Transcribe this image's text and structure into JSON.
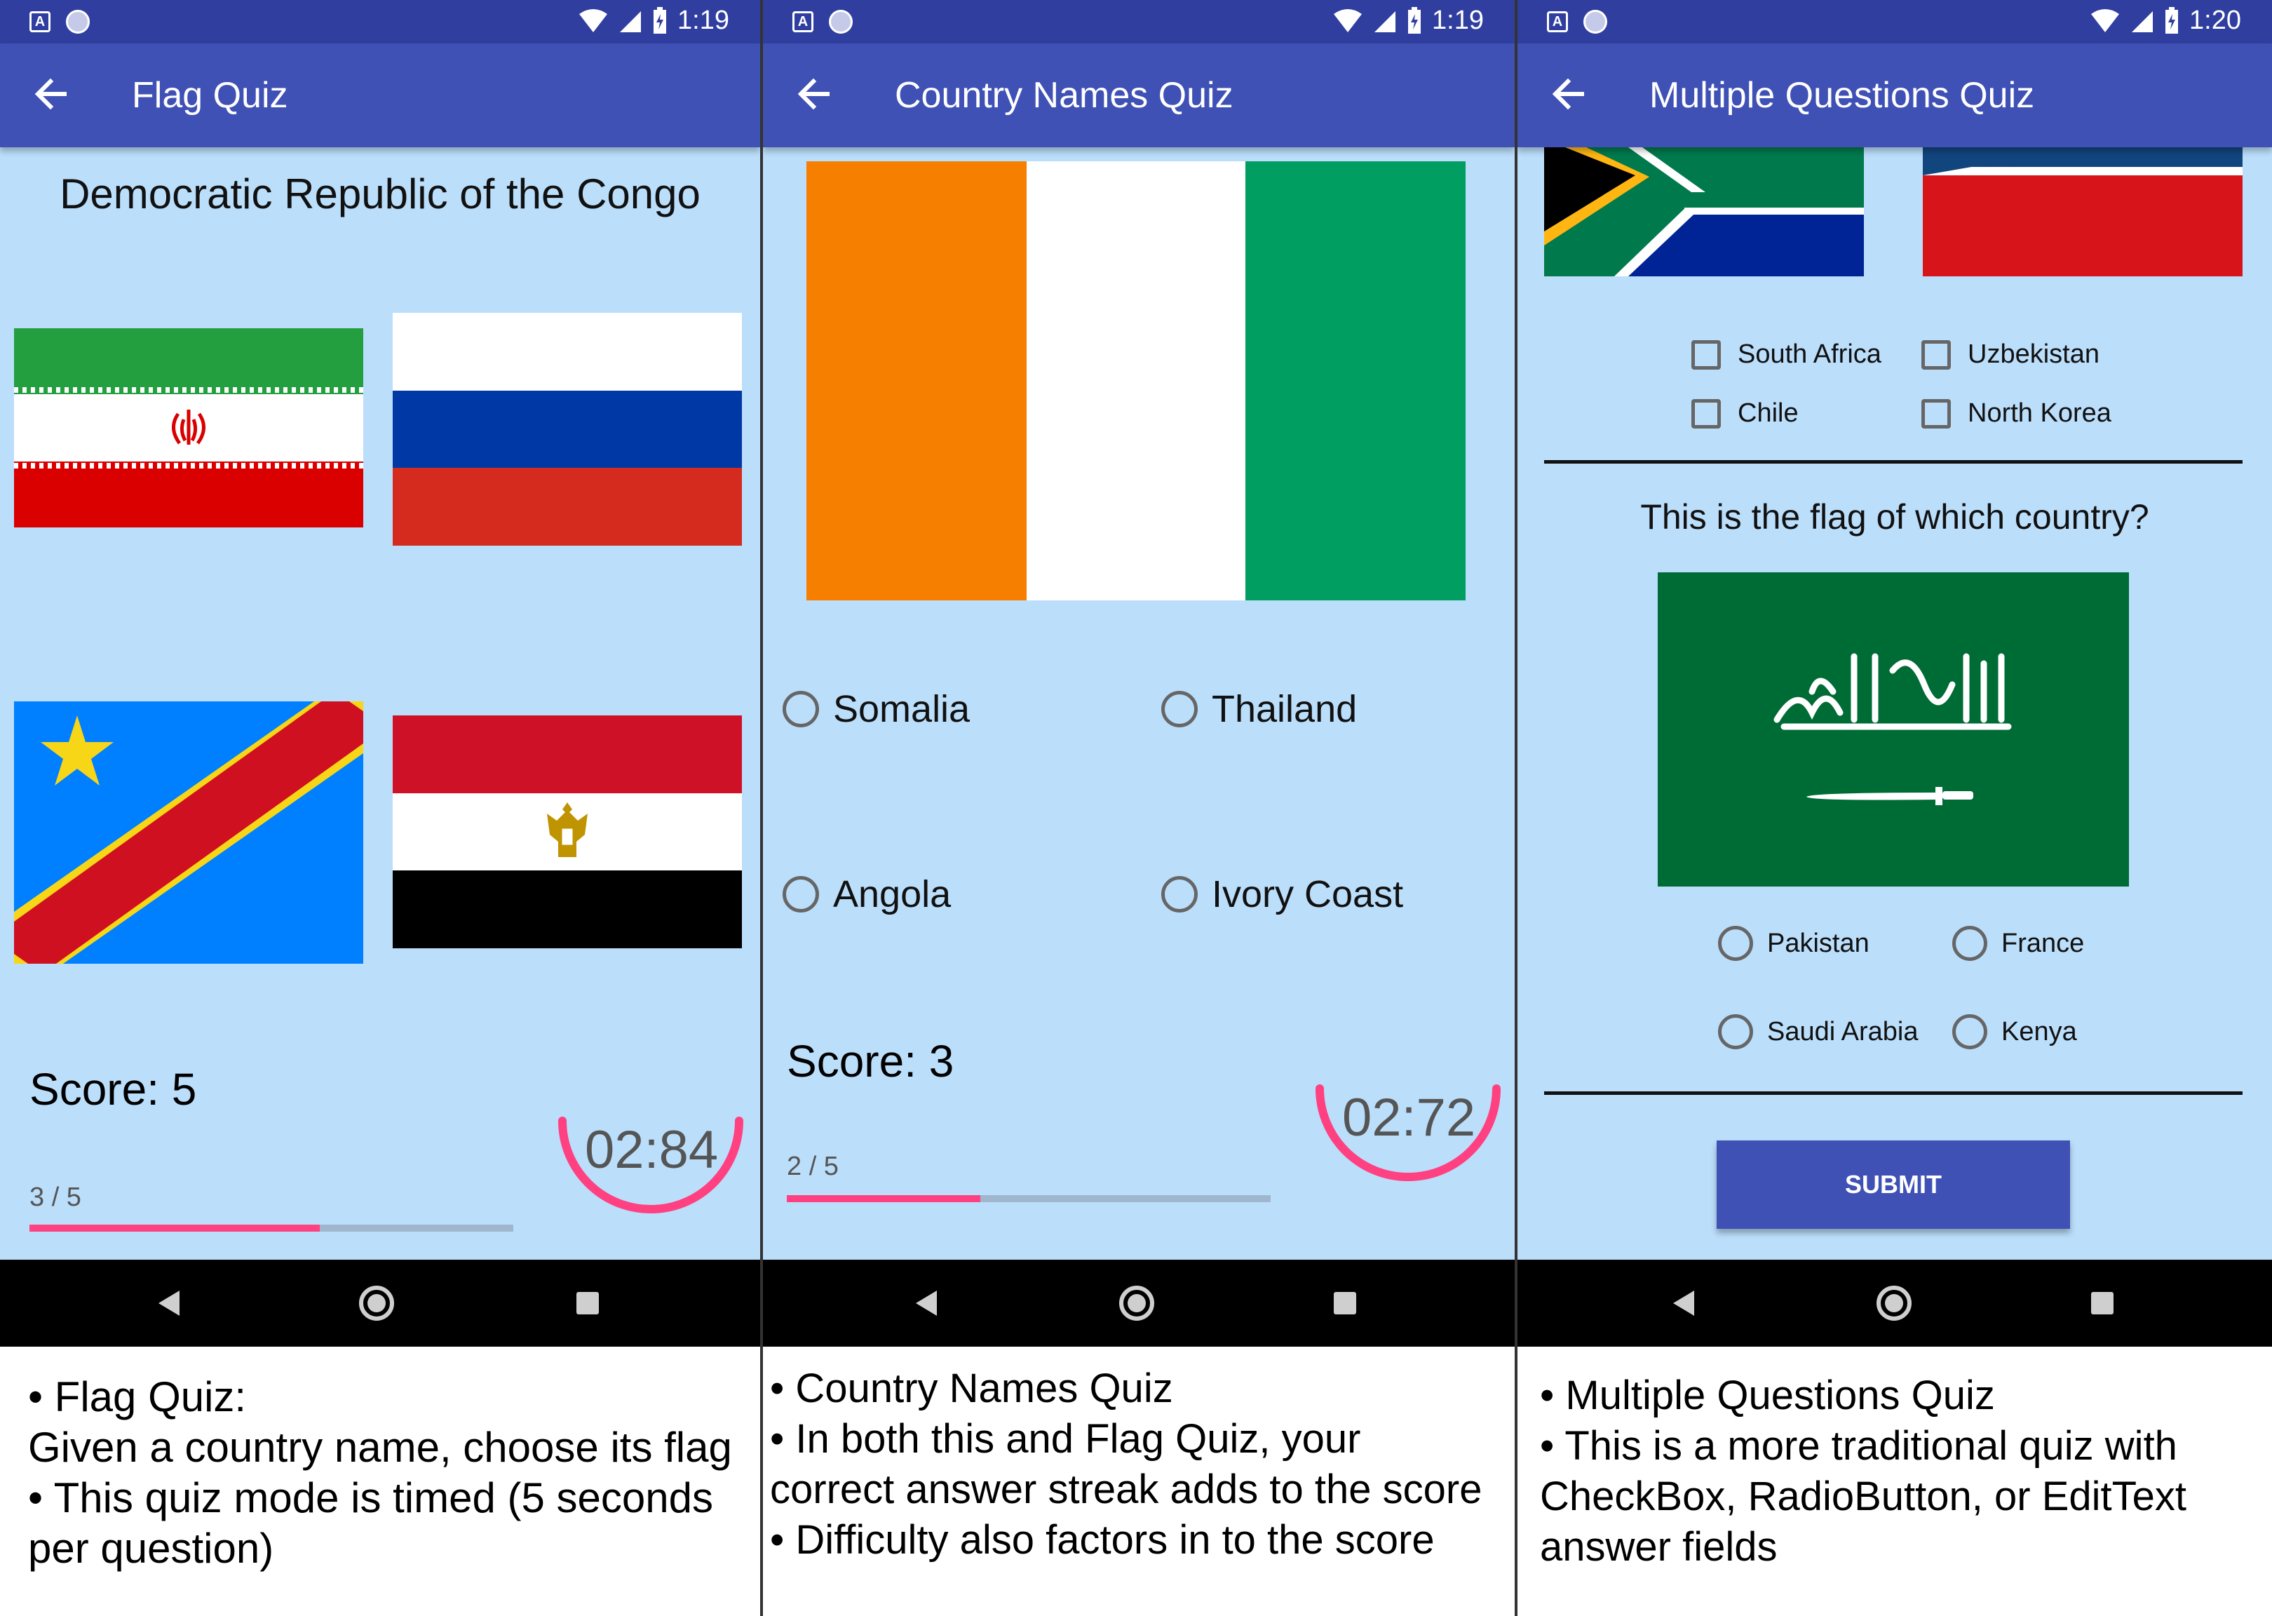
{
  "panels": [
    {
      "status": {
        "time": "1:19"
      },
      "title": "Flag Quiz",
      "question": "Democratic Republic of the Congo",
      "flags": [
        "iran-flag",
        "russia-flag",
        "dr-congo-flag",
        "egypt-flag"
      ],
      "score": "Score: 5",
      "progress": {
        "label": "3 / 5",
        "fraction": 0.6
      },
      "timer": "02:84",
      "caption": [
        "• Flag Quiz:",
        "Given a country name, choose its flag",
        "• This quiz mode is timed (5 seconds",
        "per question)"
      ]
    },
    {
      "status": {
        "time": "1:19"
      },
      "title": "Country Names Quiz",
      "flag": "ivory-coast-flag",
      "options": [
        "Somalia",
        "Thailand",
        "Angola",
        "Ivory Coast"
      ],
      "score": "Score: 3",
      "progress": {
        "label": "2 / 5",
        "fraction": 0.4
      },
      "timer": "02:72",
      "caption": [
        "• Country Names Quiz",
        "• In both this and Flag Quiz, your",
        "correct answer streak adds to the score",
        "• Difficulty also factors in to the score"
      ]
    },
    {
      "status": {
        "time": "1:20"
      },
      "title": "Multiple Questions Quiz",
      "checkboxes": [
        "South Africa",
        "Uzbekistan",
        "Chile",
        "North Korea"
      ],
      "question": "This is the flag of which country?",
      "flag": "saudi-arabia-flag",
      "radios": [
        "Pakistan",
        "France",
        "Saudi Arabia",
        "Kenya"
      ],
      "submit": "SUBMIT",
      "caption": [
        "• Multiple Questions Quiz",
        "• This is a more traditional quiz with",
        "CheckBox, RadioButton, or EditText",
        "answer fields"
      ]
    }
  ],
  "colors": {
    "primary": "#3F51B5",
    "primary_dark": "#303F9F",
    "accent": "#FF4081",
    "background": "#BBDEFB"
  }
}
